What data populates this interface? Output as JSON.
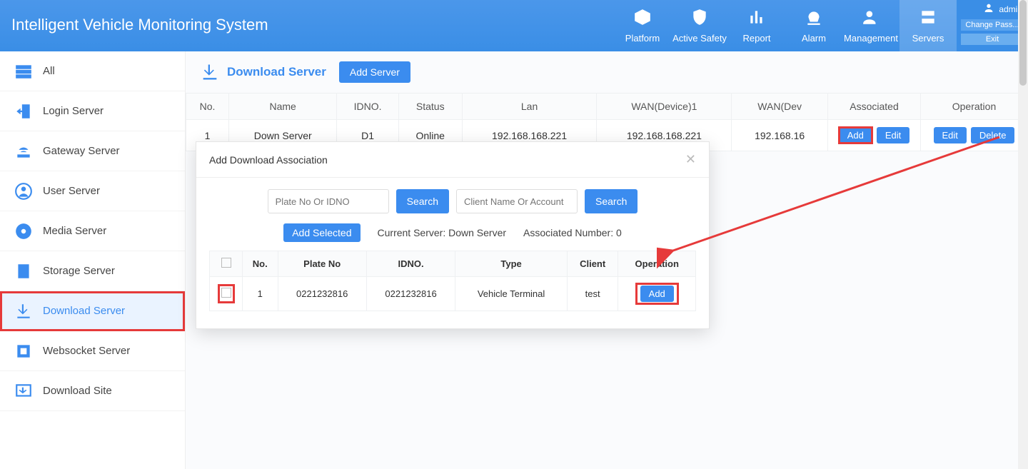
{
  "header": {
    "title": "Intelligent Vehicle Monitoring System",
    "nav": [
      "Platform",
      "Active Safety",
      "Report",
      "Alarm",
      "Management",
      "Servers"
    ],
    "active_nav": 5,
    "user": {
      "name": "admin",
      "change_pass": "Change Pass...",
      "exit": "Exit"
    }
  },
  "sidebar": {
    "items": [
      "All",
      "Login Server",
      "Gateway Server",
      "User Server",
      "Media Server",
      "Storage Server",
      "Download Server",
      "Websocket Server",
      "Download Site"
    ],
    "active": 6
  },
  "page": {
    "title": "Download Server",
    "add_server_btn": "Add Server"
  },
  "main_table": {
    "headers": [
      "No.",
      "Name",
      "IDNO.",
      "Status",
      "Lan",
      "WAN(Device)1",
      "WAN(Dev",
      "Associated",
      "Operation"
    ],
    "row": {
      "no": "1",
      "name": "Down Server",
      "idno": "D1",
      "status": "Online",
      "lan": "192.168.168.221",
      "wan1": "192.168.168.221",
      "wan2": "192.168.16",
      "assoc_add": "Add",
      "assoc_edit": "Edit",
      "op_edit": "Edit",
      "op_delete": "Delete"
    }
  },
  "modal": {
    "title": "Add Download Association",
    "plate_placeholder": "Plate No Or IDNO",
    "client_placeholder": "Client Name Or Account",
    "search_btn": "Search",
    "add_selected_btn": "Add Selected",
    "current_server_label": "Current Server: Down Server",
    "assoc_number_label": "Associated Number: 0",
    "inner_headers": [
      "",
      "No.",
      "Plate No",
      "IDNO.",
      "Type",
      "Client",
      "Operation"
    ],
    "inner_row": {
      "no": "1",
      "plate": "0221232816",
      "idno": "0221232816",
      "type": "Vehicle Terminal",
      "client": "test",
      "add": "Add"
    }
  }
}
